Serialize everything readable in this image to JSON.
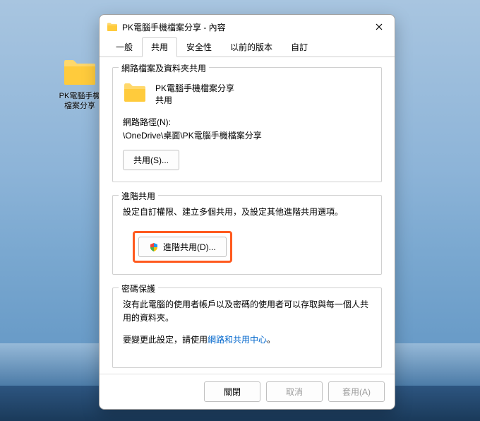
{
  "desktop": {
    "icon_label": "PK電腦手機\n檔案分享"
  },
  "window": {
    "title": "PK電腦手機檔案分享 - 內容",
    "tabs": [
      "一般",
      "共用",
      "安全性",
      "以前的版本",
      "自訂"
    ],
    "active_tab": 1
  },
  "network_share": {
    "legend": "網路檔案及資料夾共用",
    "folder_name": "PK電腦手機檔案分享",
    "status": "共用",
    "path_label": "網路路徑(N):",
    "path_value": "\\OneDrive\\桌面\\PK電腦手機檔案分享",
    "share_button": "共用(S)..."
  },
  "advanced_share": {
    "legend": "進階共用",
    "description": "設定自訂權限、建立多個共用，及設定其他進階共用選項。",
    "button": "進階共用(D)..."
  },
  "password_protect": {
    "legend": "密碼保護",
    "description": "沒有此電腦的使用者帳戶以及密碼的使用者可以存取與每一個人共用的資料夾。",
    "change_prefix": "要變更此設定，請使用",
    "link_text": "網路和共用中心",
    "change_suffix": "。"
  },
  "dialog": {
    "close": "關閉",
    "cancel": "取消",
    "apply": "套用(A)"
  }
}
